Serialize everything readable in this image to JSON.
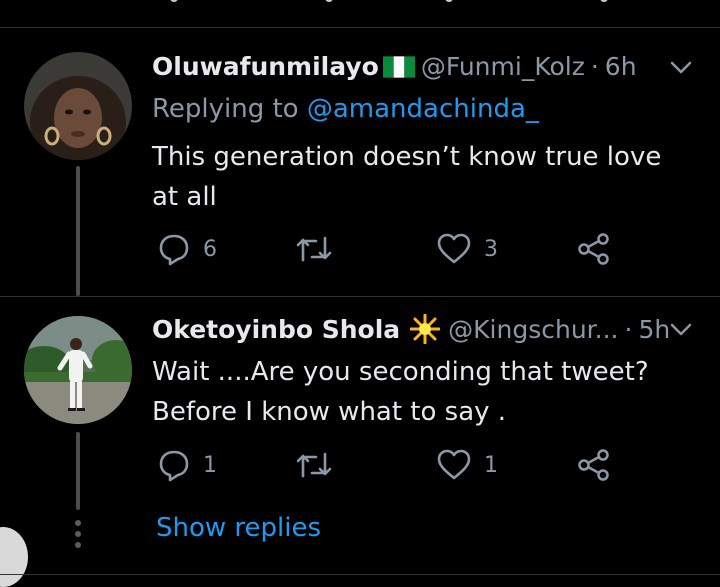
{
  "tweets": [
    {
      "display_name": "Oluwafunmilayo",
      "flag_icon": "nigeria-flag-icon",
      "handle": "@Funmi_Kolz",
      "separator": "·",
      "time": "6h",
      "replying_prefix": "Replying to",
      "replying_to": "@amandachinda_",
      "text": "This generation doesn’t know true love at all",
      "replies": "6",
      "retweets": "",
      "likes": "3"
    },
    {
      "display_name": "Oketoyinbo Shola",
      "emoji_icon": "sparkle-star-icon",
      "handle": "@Kingschur...",
      "separator": "·",
      "time": "5h",
      "text_line1": "Wait ....Are you seconding that tweet?",
      "text_line2": "Before I know what to say .",
      "replies": "1",
      "retweets": "",
      "likes": "1"
    }
  ],
  "show_replies": "Show replies",
  "colors": {
    "background": "#000000",
    "text": "#e7e9ea",
    "secondary": "#8b98a5",
    "link": "#1d9bf0",
    "divider": "#2f3336"
  }
}
